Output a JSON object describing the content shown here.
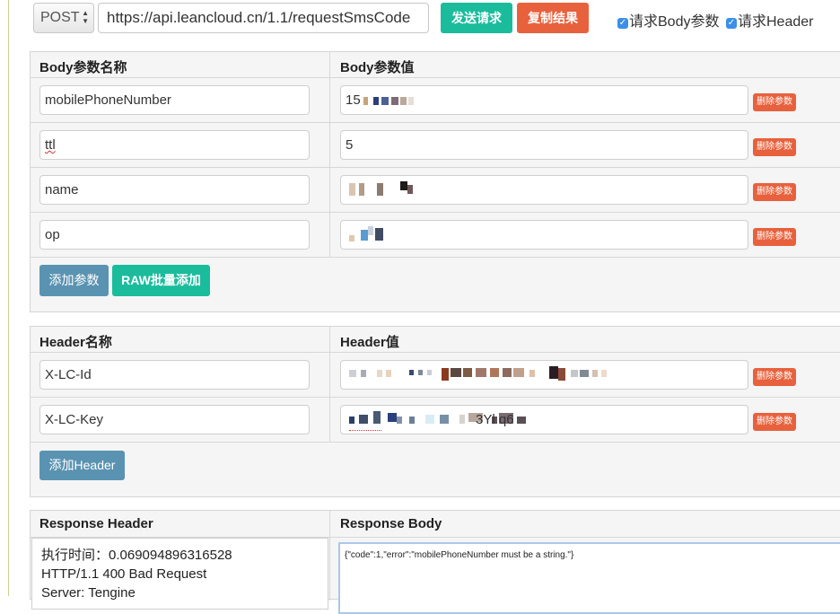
{
  "toolbar": {
    "method": "POST",
    "url": "https://api.leancloud.cn/1.1/requestSmsCode",
    "send_label": "发送请求",
    "copy_label": "复制结果",
    "body_params_check": "请求Body参数",
    "header_check": "请求Header"
  },
  "body_section": {
    "col_name": "Body参数名称",
    "col_value": "Body参数值",
    "rows": [
      {
        "name": "mobilePhoneNumber",
        "value": "15"
      },
      {
        "name": "ttl",
        "value": "5"
      },
      {
        "name": "name",
        "value": ""
      },
      {
        "name": "op",
        "value": ""
      }
    ],
    "delete_label": "删除参数",
    "add_label": "添加参数",
    "raw_add_label": "RAW批量添加"
  },
  "header_section": {
    "col_name": "Header名称",
    "col_value": "Header值",
    "rows": [
      {
        "name": "X-LC-Id",
        "value": ""
      },
      {
        "name": "X-LC-Key",
        "value": "3Yl  q6"
      }
    ],
    "delete_label": "删除参数",
    "add_label": "添加Header"
  },
  "response": {
    "header_title": "Response Header",
    "body_title": "Response Body",
    "header_lines": [
      "执行时间：0.069094896316528",
      "HTTP/1.1 400 Bad Request",
      "Server: Tengine"
    ],
    "body_text": "{\"code\":1,\"error\":\"mobilePhoneNumber must be a string.\"}"
  },
  "colors": {
    "green": "#1abc9c",
    "red": "#e8613d",
    "blue": "#5a93b1",
    "panel_bg": "#f5f5f5"
  }
}
